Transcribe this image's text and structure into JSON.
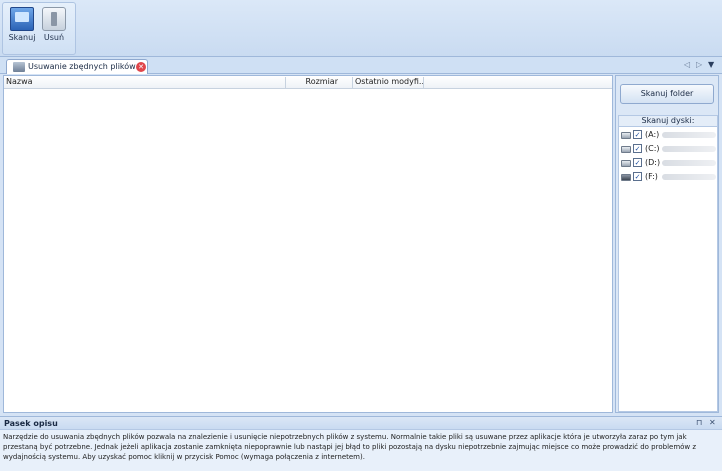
{
  "ribbon": {
    "buttons": [
      {
        "label": "Skanuj",
        "icon": "scan-icon"
      },
      {
        "label": "Usuń",
        "icon": "delete-icon"
      }
    ]
  },
  "tabs": [
    {
      "label": "Usuwanie zbędnych plików",
      "icon": "cleanup-tab-icon"
    }
  ],
  "list": {
    "columns": [
      "Nazwa",
      "Rozmiar",
      "Ostatnio modyfi..."
    ]
  },
  "side": {
    "scan_folder_label": "Skanuj folder",
    "drives_header": "Skanuj dyski:",
    "drives": [
      {
        "label": "(A:)",
        "checked": true
      },
      {
        "label": "(C:)",
        "checked": true
      },
      {
        "label": "(D:)",
        "checked": true
      },
      {
        "label": "(F:)",
        "checked": true
      }
    ]
  },
  "description": {
    "title": "Pasek opisu",
    "text": "Narzędzie do usuwania zbędnych plików pozwala na znalezienie i usunięcie niepotrzebnych plików z systemu. Normalnie takie pliki są usuwane przez aplikacje która je utworzyła zaraz po tym jak przestaną być potrzebne. Jednak jeżeli aplikacja zostanie zamknięta niepoprawnie lub nastąpi jej błąd to pliki pozostają na dysku niepotrzebnie zajmując miejsce co może prowadzić do problemów z wydajnością systemu. Aby uzyskać pomoc kliknij w przycisk Pomoc (wymaga połączenia z internetem)."
  },
  "colors": {
    "accent": "#9fb8da",
    "background": "#d5e3f5",
    "close_red": "#e0464b"
  }
}
